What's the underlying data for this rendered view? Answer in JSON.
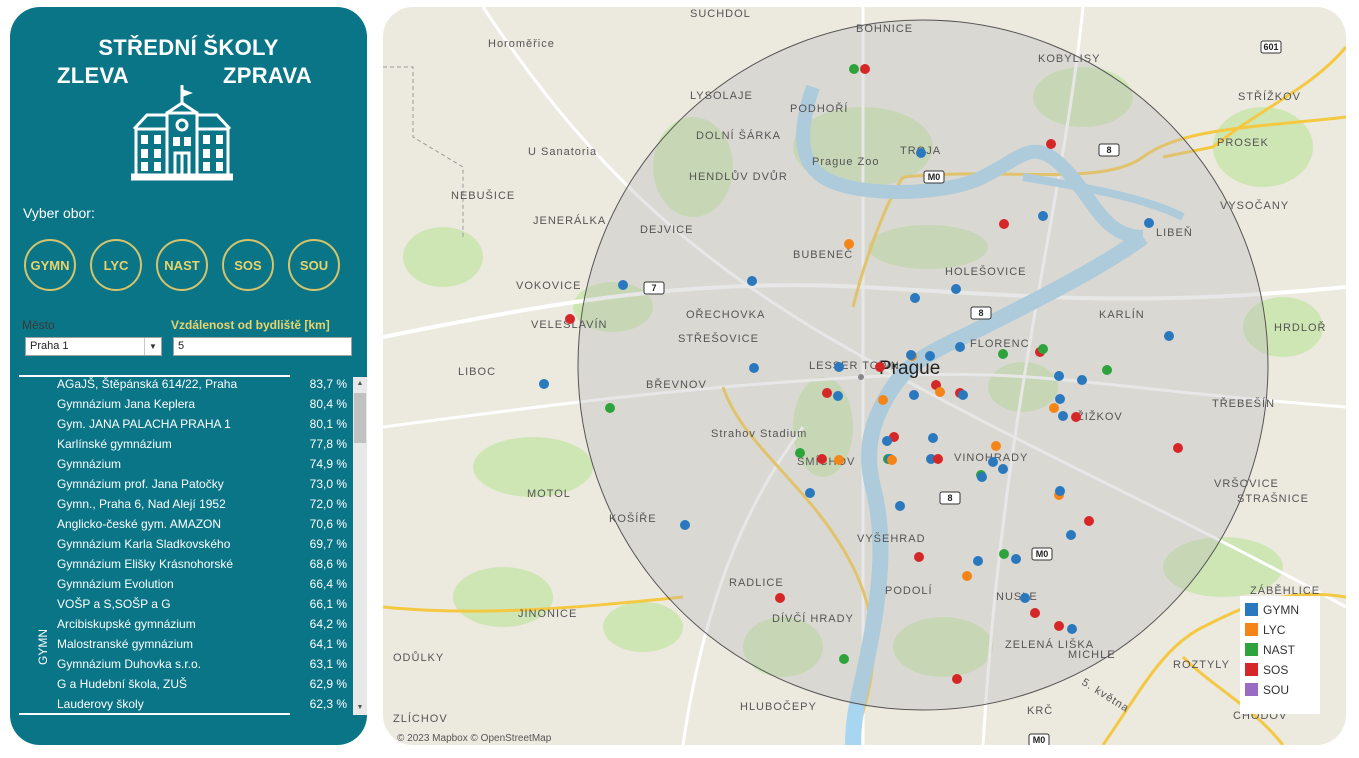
{
  "sidebar": {
    "title_line1": "STŘEDNÍ ŠKOLY",
    "title_left": "ZLEVA",
    "title_right": "ZPRAVA",
    "select_label": "Vyber obor:",
    "buttons": [
      "GYMN",
      "LYC",
      "NAST",
      "SOS",
      "SOU"
    ],
    "mesto_label": "Město",
    "mesto_value": "Praha 1",
    "vzdalenost_label": "Vzdálenost od bydliště [km]",
    "vzdalenost_value": "5",
    "group_label": "GYMN",
    "schools": [
      {
        "name": "AGaJŠ, Štěpánská 614/22, Praha",
        "pct": "83,7 %"
      },
      {
        "name": "Gymnázium Jana Keplera",
        "pct": "80,4 %"
      },
      {
        "name": "Gym. JANA PALACHA PRAHA 1",
        "pct": "80,1 %"
      },
      {
        "name": "Karlínské gymnázium",
        "pct": "77,8 %"
      },
      {
        "name": "Gymnázium",
        "pct": "74,9 %"
      },
      {
        "name": "Gymnázium prof. Jana Patočky",
        "pct": "73,0 %"
      },
      {
        "name": "Gymn., Praha 6, Nad Alejí 1952",
        "pct": "72,0 %"
      },
      {
        "name": "Anglicko-české gym. AMAZON",
        "pct": "70,6 %"
      },
      {
        "name": "Gymnázium Karla Sladkovského",
        "pct": "69,7 %"
      },
      {
        "name": "Gymnázium Elišky Krásnohorské",
        "pct": "68,6 %"
      },
      {
        "name": "Gymnázium Evolution",
        "pct": "66,4 %"
      },
      {
        "name": "VOŠP a S,SOŠP a G",
        "pct": "66,1 %"
      },
      {
        "name": "Arcibiskupské gymnázium",
        "pct": "64,2 %"
      },
      {
        "name": "Malostranské gymnázium",
        "pct": "64,1 %"
      },
      {
        "name": "Gymnázium Duhovka s.r.o.",
        "pct": "63,1 %"
      },
      {
        "name": "G a Hudební škola, ZUŠ",
        "pct": "62,9 %"
      },
      {
        "name": "Lauderovy školy",
        "pct": "62,3 %"
      }
    ]
  },
  "map": {
    "city_label": "Prague",
    "attribution": "© 2023 Mapbox © OpenStreetMap",
    "places": [
      "SUCHDOL",
      "BOHNICE",
      "Horoměřice",
      "KOBYLISY",
      "LYSOLAJE",
      "PODHOŘÍ",
      "STŘÍŽKOV",
      "DOLNÍ ŠÁRKA",
      "U Sanatoria",
      "Prague Zoo",
      "TROJA",
      "PROSEK",
      "HENDLŮV DVŮR",
      "NEBUŠICE",
      "JENERÁLKA",
      "DEJVICE",
      "BUBENEČ",
      "VYSOČANY",
      "LIBEŇ",
      "HOLEŠOVICE",
      "VOKOVICE",
      "OŘECHOVKA",
      "KARLÍN",
      "VELESLAVÍN",
      "STŘEŠOVICE",
      "FLORENC",
      "HRDLOŘ",
      "LESSER TOWN",
      "LIBOC",
      "BŘEVNOV",
      "ŽIŽKOV",
      "TŘEBEŠÍN",
      "Strahov Stadium",
      "SMÍCHOV",
      "VINOHRADY",
      "MOTOL",
      "VRŠOVICE",
      "STRAŠNICE",
      "KOŠÍŘE",
      "VYŠEHRAD",
      "ZÁBĚHLICE",
      "RADLICE",
      "PODOLÍ",
      "NUSLE",
      "JINONICE",
      "DÍVČÍ HRADY",
      "ZELENÁ LIŠKA",
      "MICHLE",
      "ODŮLKY",
      "ROZTYLY",
      "HLUBOČEPY",
      "KRČ",
      "5. května",
      "ZLÍCHOV",
      "CHODOV"
    ],
    "road_labels": [
      "601",
      "8",
      "M0",
      "7",
      "8",
      "8",
      "M0",
      "M0"
    ],
    "legend": [
      {
        "label": "GYMN",
        "color": "#2a78bd"
      },
      {
        "label": "LYC",
        "color": "#f58518"
      },
      {
        "label": "NAST",
        "color": "#2ea33b"
      },
      {
        "label": "SOS",
        "color": "#d62728"
      },
      {
        "label": "SOU",
        "color": "#9a6bc2"
      }
    ],
    "colors": {
      "water": "#a8d5ef",
      "park": "#c9e5ad",
      "motorway": "#f5c842",
      "circle_fill": "rgba(185,185,185,0.35)"
    }
  }
}
